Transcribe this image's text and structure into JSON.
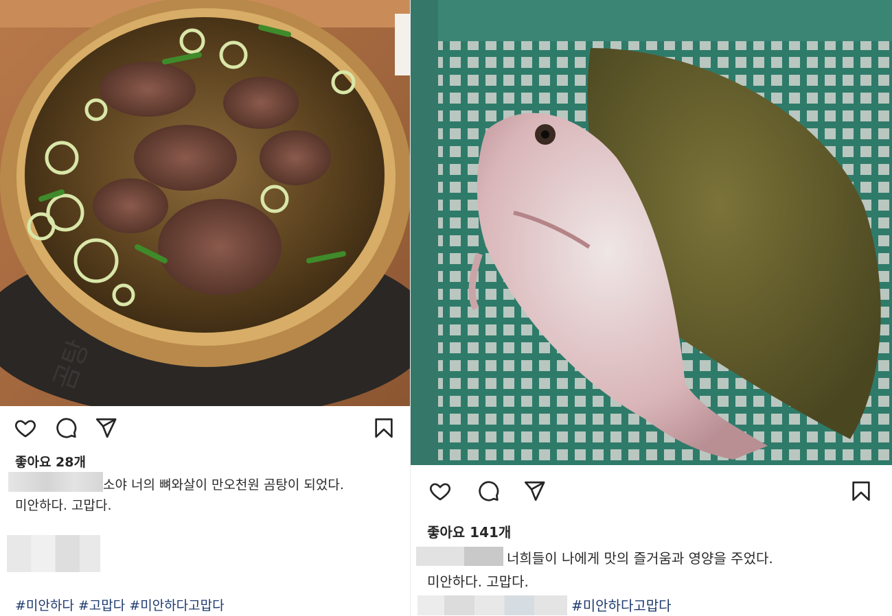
{
  "left_post": {
    "likes": "좋아요 28개",
    "caption_line1": "소야 너의 뼈와살이 만오천원 곰탕이 되었다.",
    "caption_line2": "미안하다. 고맙다.",
    "hashtags": "#미안하다 #고맙다 #미안하다고맙다",
    "icons": [
      "heart-icon",
      "comment-icon",
      "share-icon",
      "bookmark-icon"
    ]
  },
  "right_post": {
    "likes": "좋아요 141개",
    "caption_line1": "너희들이 나에게 맛의 즐거움과 영양을 주었다.",
    "caption_line2": "미안하다. 고맙다.",
    "hashtags": "#미안하다고맙다",
    "icons": [
      "heart-icon",
      "comment-icon",
      "share-icon",
      "bookmark-icon"
    ]
  },
  "colors": {
    "text": "#262626",
    "hashtag": "#1e3a6e",
    "blur_gray": "#d9d9d9"
  }
}
